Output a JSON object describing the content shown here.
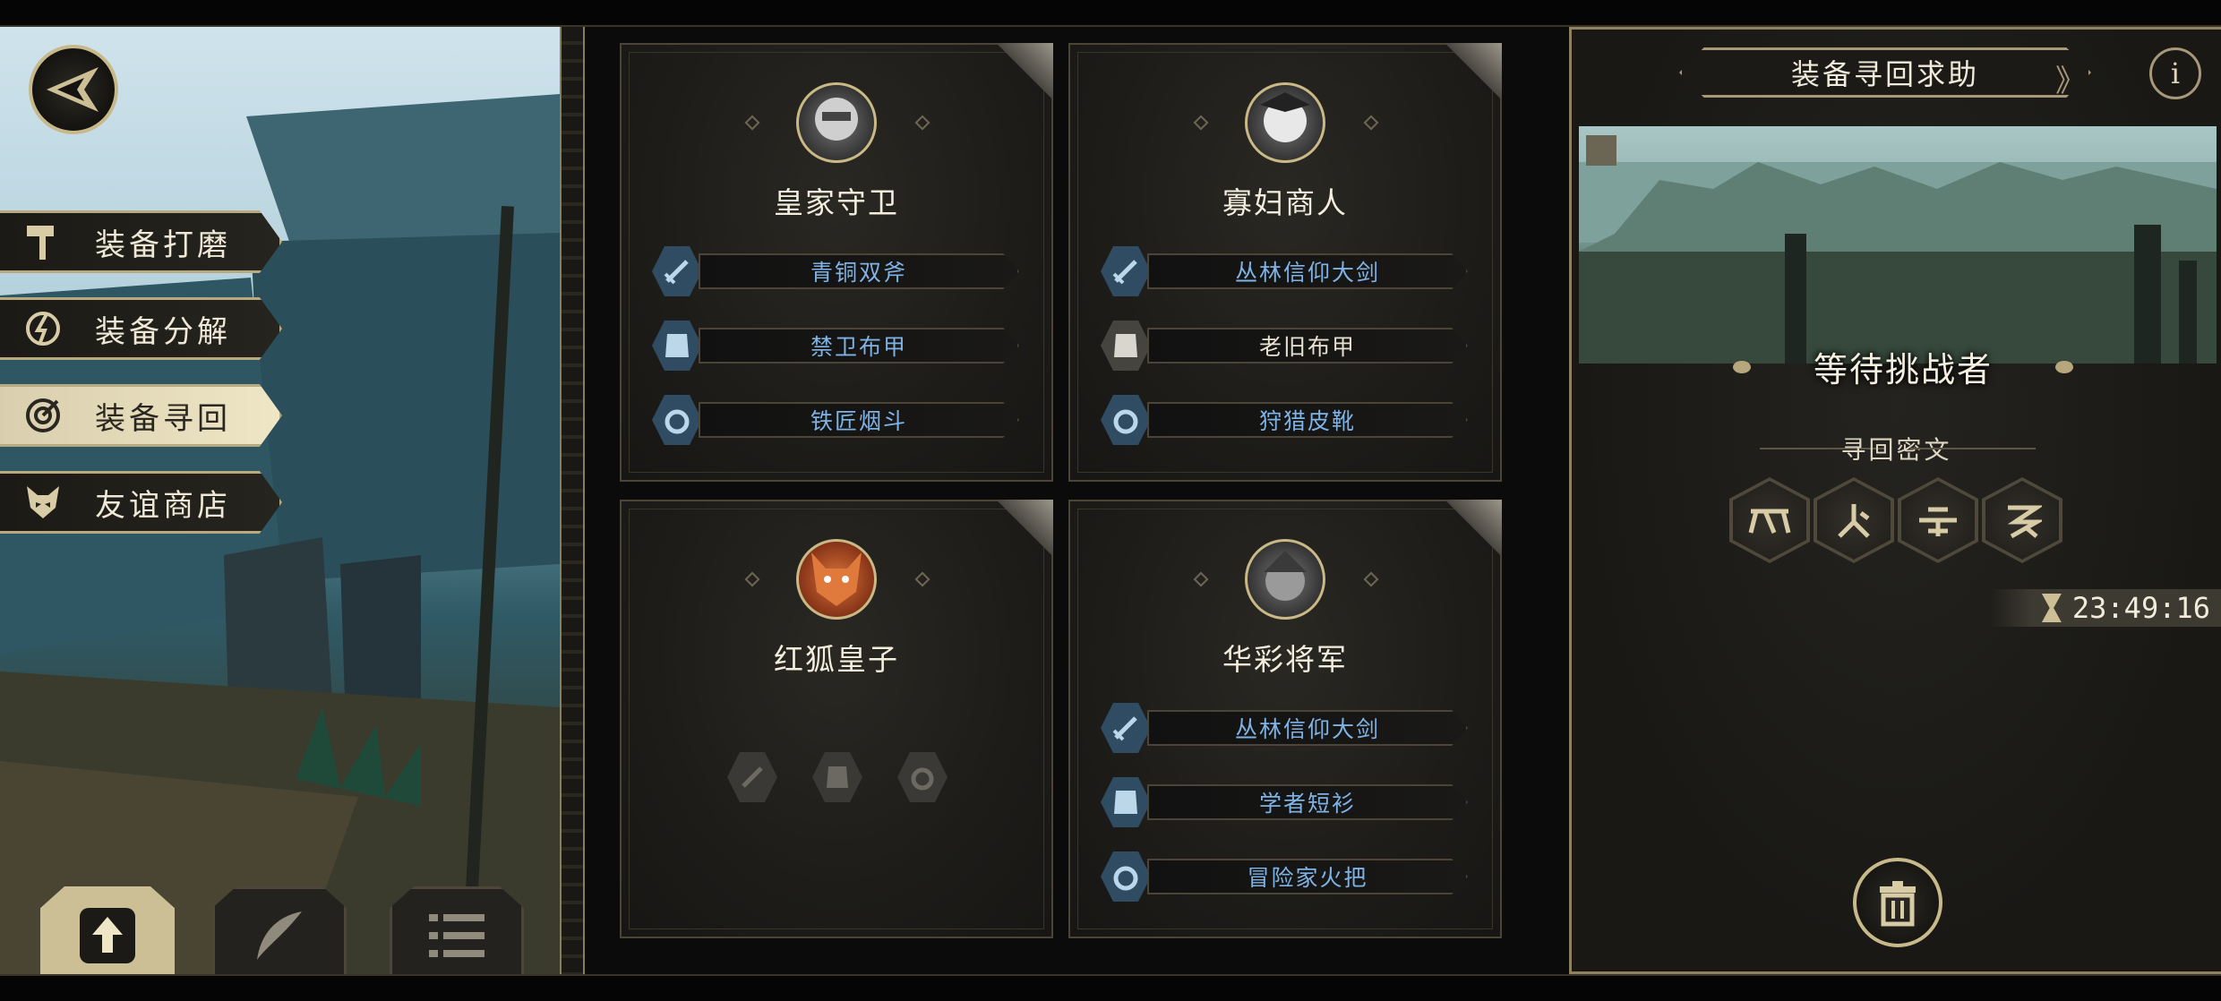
{
  "menu": {
    "items": [
      {
        "label": "装备打磨",
        "icon": "hammer-icon",
        "active": false
      },
      {
        "label": "装备分解",
        "icon": "disassemble-icon",
        "active": false
      },
      {
        "label": "装备寻回",
        "icon": "target-icon",
        "active": true
      },
      {
        "label": "友谊商店",
        "icon": "fox-head-icon",
        "active": false
      }
    ]
  },
  "bottom_buttons": [
    "upload-icon",
    "feather-icon",
    "list-icon"
  ],
  "cards": [
    {
      "name": "皇家守卫",
      "items": [
        {
          "label": "青铜双斧",
          "color": "blue"
        },
        {
          "label": "禁卫布甲",
          "color": "blue"
        },
        {
          "label": "铁匠烟斗",
          "color": "blue"
        }
      ]
    },
    {
      "name": "寡妇商人",
      "items": [
        {
          "label": "丛林信仰大剑",
          "color": "blue"
        },
        {
          "label": "老旧布甲",
          "color": "white"
        },
        {
          "label": "狩猎皮靴",
          "color": "blue"
        }
      ]
    },
    {
      "name": "红狐皇子",
      "items": []
    },
    {
      "name": "华彩将军",
      "items": [
        {
          "label": "丛林信仰大剑",
          "color": "blue"
        },
        {
          "label": "学者短衫",
          "color": "blue"
        },
        {
          "label": "冒险家火把",
          "color": "blue"
        }
      ]
    }
  ],
  "panel": {
    "title": "装备寻回求助",
    "info_label": "i",
    "status": "等待挑战者",
    "rune_title": "寻回密文",
    "timer": "23:49:16"
  },
  "colors": {
    "gold": "#c8b98a",
    "blue_text": "#7fb3e6",
    "dark": "#1b1a17"
  }
}
